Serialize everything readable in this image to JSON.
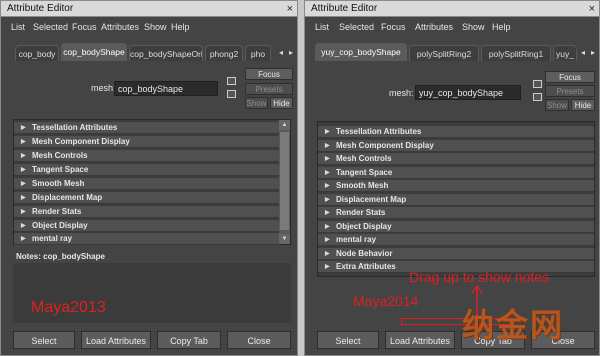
{
  "left": {
    "title": "Attribute Editor",
    "close": "×",
    "menu": [
      "List",
      "Selected",
      "Focus",
      "Attributes",
      "Show",
      "Help"
    ],
    "tabs": [
      "cop_body",
      "cop_bodyShape",
      "cop_bodyShapeOrig",
      "phong2",
      "pho"
    ],
    "active_tab": 1,
    "mesh_label": "mesh:",
    "mesh_value": "cop_bodyShape",
    "focus": "Focus",
    "presets": "Presets",
    "show": "Show",
    "hide": "Hide",
    "sections": [
      "Tessellation Attributes",
      "Mesh Component Display",
      "Mesh Controls",
      "Tangent Space",
      "Smooth Mesh",
      "Displacement Map",
      "Render Stats",
      "Object Display",
      "mental ray"
    ],
    "notes_label": "Notes:  cop_bodyShape",
    "version_label": "Maya2013",
    "buttons": [
      "Select",
      "Load Attributes",
      "Copy Tab",
      "Close"
    ]
  },
  "right": {
    "title": "Attribute Editor",
    "close": "×",
    "menu": [
      "List",
      "Selected",
      "Focus",
      "Attributes",
      "Show",
      "Help"
    ],
    "tabs": [
      "yuy_cop_bodyShape",
      "polySplitRing2",
      "polySplitRing1",
      "yuy_"
    ],
    "active_tab": 0,
    "mesh_label": "mesh:",
    "mesh_value": "yuy_cop_bodyShape",
    "focus": "Focus",
    "presets": "Presets",
    "show": "Show",
    "hide": "Hide",
    "sections": [
      "Tessellation Attributes",
      "Mesh Component Display",
      "Mesh Controls",
      "Tangent Space",
      "Smooth Mesh",
      "Displacement Map",
      "Render Stats",
      "Object Display",
      "mental ray",
      "Node Behavior",
      "Extra Attributes"
    ],
    "annotation": "Drag up to show notes",
    "version_label": "Maya2014",
    "buttons": [
      "Select",
      "Load Attributes",
      "Copy Tab",
      "Close"
    ]
  },
  "watermark": "纳金网",
  "colors": {
    "annotation_red": "#e02020",
    "window_bg": "#444444",
    "row_bg": "#505050"
  }
}
